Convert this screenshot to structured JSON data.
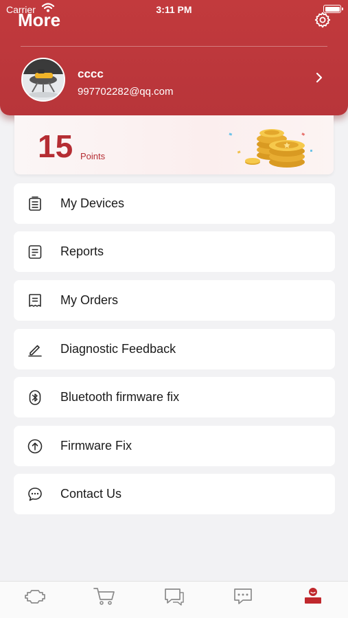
{
  "status_bar": {
    "carrier": "Carrier",
    "time": "3:11 PM"
  },
  "header": {
    "title": "More"
  },
  "profile": {
    "username": "cccc",
    "email": "997702282@qq.com"
  },
  "points": {
    "value": "15",
    "label": "Points"
  },
  "menu": {
    "items": [
      {
        "label": "My Devices",
        "icon": "devices-icon"
      },
      {
        "label": "Reports",
        "icon": "document-icon"
      },
      {
        "label": "My Orders",
        "icon": "receipt-icon"
      },
      {
        "label": "Diagnostic Feedback",
        "icon": "pencil-icon"
      },
      {
        "label": "Bluetooth firmware fix",
        "icon": "bluetooth-icon"
      },
      {
        "label": "Firmware Fix",
        "icon": "upload-arrow-icon"
      },
      {
        "label": "Contact Us",
        "icon": "chat-bubble-icon"
      }
    ]
  },
  "tabbar": {
    "tabs": [
      {
        "icon": "engine-icon",
        "active": false
      },
      {
        "icon": "cart-icon",
        "active": false
      },
      {
        "icon": "message-icon",
        "active": false
      },
      {
        "icon": "chat-icon",
        "active": false
      },
      {
        "icon": "profile-icon",
        "active": true
      }
    ]
  },
  "colors": {
    "brand_red": "#b8353a",
    "inactive_icon": "#8a8a8a",
    "background": "#f2f2f4"
  }
}
